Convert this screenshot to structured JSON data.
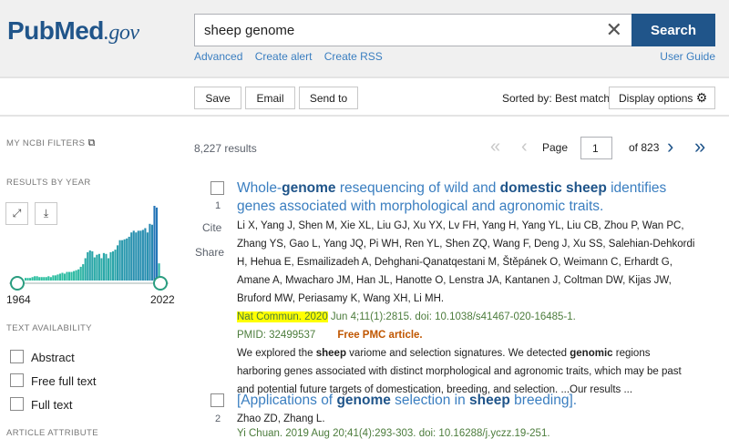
{
  "header": {
    "logo_main": "PubMed",
    "logo_suffix": ".gov",
    "search_value": "sheep genome",
    "search_button": "Search",
    "links": [
      "Advanced",
      "Create alert",
      "Create RSS"
    ],
    "user_guide": "User Guide"
  },
  "toolbar": {
    "save": "Save",
    "email": "Email",
    "send_to": "Send to",
    "sorted_by": "Sorted by: Best match",
    "display_options": "Display options"
  },
  "sidebar": {
    "my_ncbi_filters": "MY NCBI FILTERS",
    "results_by_year": "RESULTS BY YEAR",
    "year_start": "1964",
    "year_end": "2022",
    "histogram_relative": [
      3,
      3,
      3,
      4,
      5,
      5,
      4,
      4,
      4,
      4,
      5,
      4,
      6,
      6,
      7,
      8,
      9,
      8,
      10,
      10,
      10,
      11,
      12,
      13,
      16,
      19,
      26,
      33,
      35,
      34,
      27,
      30,
      31,
      26,
      32,
      31,
      26,
      33,
      34,
      36,
      41,
      47,
      47,
      48,
      49,
      51,
      56,
      58,
      56,
      58,
      58,
      59,
      61,
      56,
      66,
      65,
      87,
      85,
      20
    ],
    "text_availability": "TEXT AVAILABILITY",
    "filters": [
      "Abstract",
      "Free full text",
      "Full text"
    ],
    "article_attribute": "ARTICLE ATTRIBUTE"
  },
  "results": {
    "count": "8,227 results",
    "page_label": "Page",
    "page_value": "1",
    "of_pages": "of 823",
    "items": [
      {
        "num": "1",
        "cite": "Cite",
        "share": "Share",
        "title_parts": [
          "Whole-",
          "genome",
          " resequencing of wild and ",
          "domestic sheep",
          " identifies genes associated with morphological and agronomic traits."
        ],
        "authors": "Li X, Yang J, Shen M, Xie XL, Liu GJ, Xu YX, Lv FH, Yang H, Yang YL, Liu CB, Zhou P, Wan PC, Zhang YS, Gao L, Yang JQ, Pi WH, Ren YL, Shen ZQ, Wang F, Deng J, Xu SS, Salehian-Dehkordi H, Hehua E, Esmailizadeh A, Dehghani-Qanatqestani M, Štěpánek O, Weimann C, Erhardt G, Amane A, Mwacharo JM, Han JL, Hanotte O, Lenstra JA, Kantanen J, Coltman DW, Kijas JW, Bruford MW, Periasamy K, Wang XH, Li MH.",
        "journal": "Nat Commun. 2020",
        "citation": " Jun 4;11(1):2815. doi: 10.1038/s41467-020-16485-1.",
        "pmid": "PMID: 32499537",
        "free": "Free PMC article.",
        "snippet_parts": [
          "We explored the ",
          "sheep",
          " variome and selection signatures. We detected ",
          "genomic",
          " regions harboring genes associated with distinct morphological and agronomic traits, which may be past and potential future targets of domestication, breeding, and selection. ...Our results ..."
        ]
      },
      {
        "num": "2",
        "title_parts": [
          "[Applications of ",
          "genome",
          " selection in ",
          "sheep",
          " breeding]."
        ],
        "authors": "Zhao ZD, Zhang L.",
        "citation": "Yi Chuan. 2019 Aug 20;41(4):293-303. doi: 10.16288/j.yczz.19-251."
      }
    ]
  },
  "colors": {
    "brand": "#20558a",
    "link": "#3a7ec0",
    "free": "#c05600",
    "bar_low": "#2fc4a0",
    "bar_high": "#2574b8"
  }
}
